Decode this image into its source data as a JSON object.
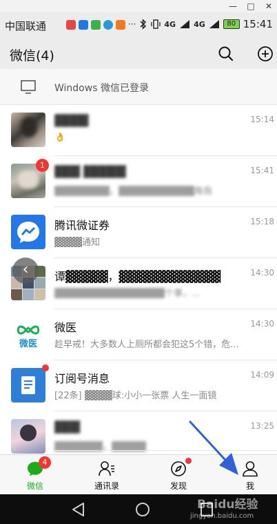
{
  "window": {
    "minimize_glyph": "—",
    "maximize_glyph": "□",
    "close_glyph": "✕"
  },
  "statusbar": {
    "carrier": "中国联通",
    "notif_more": "···",
    "net_label": "4G",
    "net_label_2": "4G",
    "battery": "80",
    "time": "15:41"
  },
  "header": {
    "title": "微信(4)"
  },
  "banner": {
    "text": "Windows 微信已登录"
  },
  "chats": [
    {
      "name": "▓▓▓▓",
      "preview": "👌",
      "time": "15:14"
    },
    {
      "name": "▓▓▓ ▓▓▓▓▓",
      "preview": "▓▓▓▓▓▓▓▓，▓▓▓▓▓▓▓▓▓▓▓角我",
      "time": "15:41",
      "badge": "1"
    },
    {
      "name": "腾讯微证券",
      "preview": "▓▓▓▓通知",
      "time": "15:18"
    },
    {
      "name": "谭▓▓▓▓▓，▓▓▓▓▓▓▓▓▓▓▓▓",
      "preview": "▓▓▓▓▓▓▓▓▓▓▓▓▓▓▓▓个事，...",
      "time": "14:30"
    },
    {
      "name": "微医",
      "preview": "趁早戒！大多数人上厕所都会犯这5个错，危...",
      "time": "14:30"
    },
    {
      "name": "订阅号消息",
      "preview": "[22条] ▓▓▓▓球:小小一张票 人生一面镜",
      "time": "14:09"
    },
    {
      "name": "▓▓▓",
      "preview": "▓▓▓▓▓▓▓，▓▓▓▓▓",
      "time": "13:25"
    }
  ],
  "float_back_glyph": "‹",
  "tabs": [
    {
      "label": "微信",
      "icon": "chat-bubble-icon",
      "badge": "4",
      "active": true
    },
    {
      "label": "通讯录",
      "icon": "contacts-icon"
    },
    {
      "label": "发现",
      "icon": "compass-icon",
      "dot": true
    },
    {
      "label": "我",
      "icon": "person-icon"
    }
  ],
  "watermark": {
    "top": "Baidu经验",
    "bottom": "jingyan.baidu.com"
  },
  "colors": {
    "accent": "#1aad19",
    "badge": "#f43530",
    "arrow": "#2e62d6"
  }
}
